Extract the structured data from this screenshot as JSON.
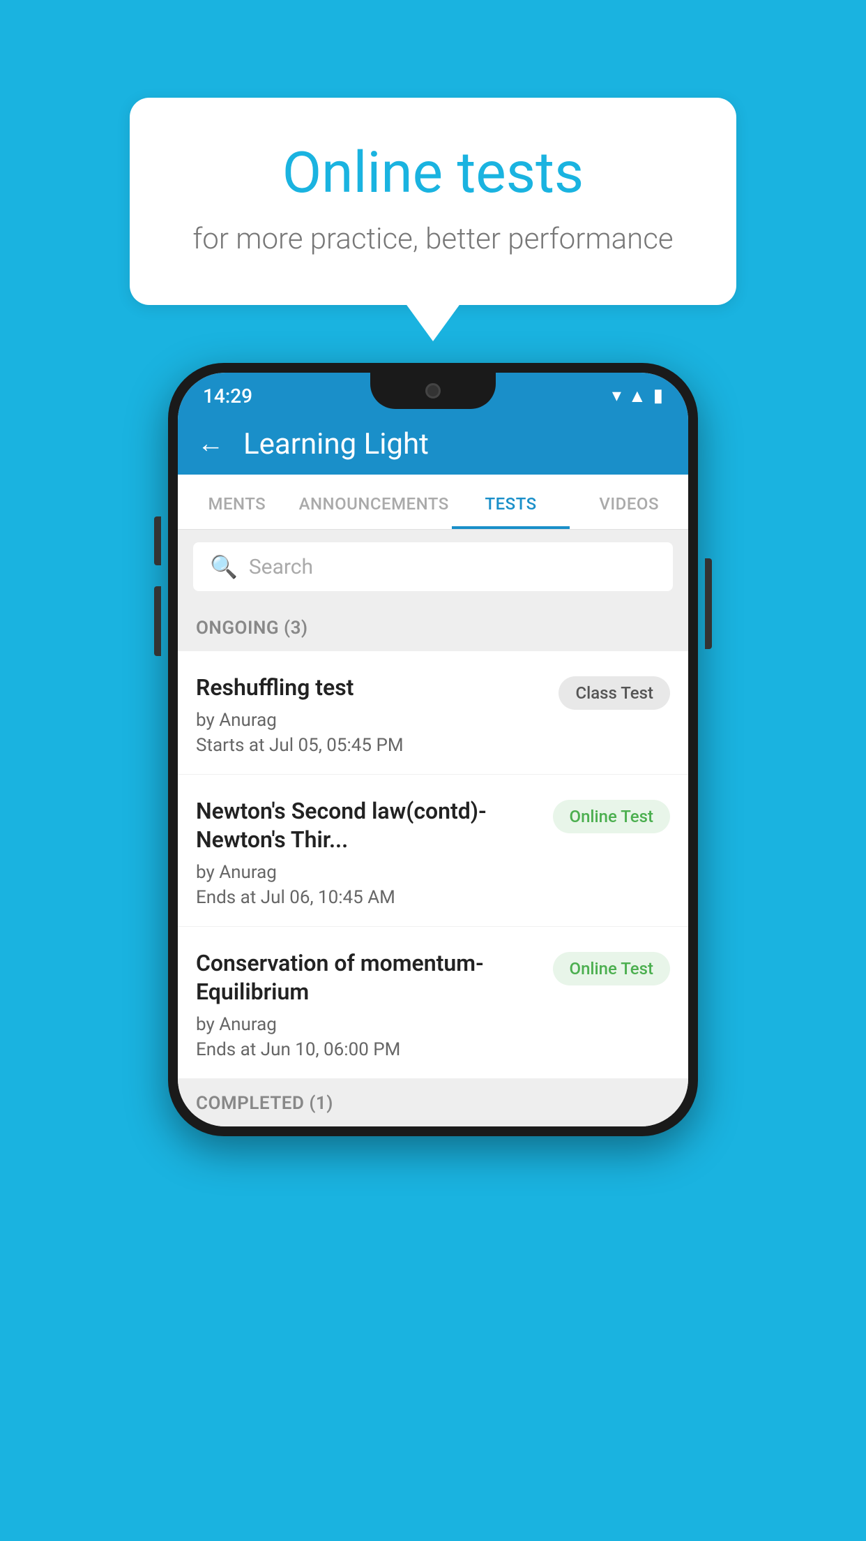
{
  "background_color": "#1ab3e0",
  "speech_bubble": {
    "title": "Online tests",
    "subtitle": "for more practice, better performance"
  },
  "phone": {
    "status_bar": {
      "time": "14:29",
      "wifi": "▼",
      "signal": "▲",
      "battery": "▮"
    },
    "app_bar": {
      "back_label": "←",
      "title": "Learning Light"
    },
    "tabs": [
      {
        "label": "MENTS",
        "active": false
      },
      {
        "label": "ANNOUNCEMENTS",
        "active": false
      },
      {
        "label": "TESTS",
        "active": true
      },
      {
        "label": "VIDEOS",
        "active": false
      }
    ],
    "search": {
      "placeholder": "Search"
    },
    "ongoing_section": {
      "label": "ONGOING (3)"
    },
    "tests": [
      {
        "title": "Reshuffling test",
        "author": "by Anurag",
        "time_label": "Starts at",
        "time": "Jul 05, 05:45 PM",
        "badge": "Class Test",
        "badge_type": "class"
      },
      {
        "title": "Newton's Second law(contd)-Newton's Thir...",
        "author": "by Anurag",
        "time_label": "Ends at",
        "time": "Jul 06, 10:45 AM",
        "badge": "Online Test",
        "badge_type": "online"
      },
      {
        "title": "Conservation of momentum-Equilibrium",
        "author": "by Anurag",
        "time_label": "Ends at",
        "time": "Jun 10, 06:00 PM",
        "badge": "Online Test",
        "badge_type": "online"
      }
    ],
    "completed_section": {
      "label": "COMPLETED (1)"
    }
  }
}
